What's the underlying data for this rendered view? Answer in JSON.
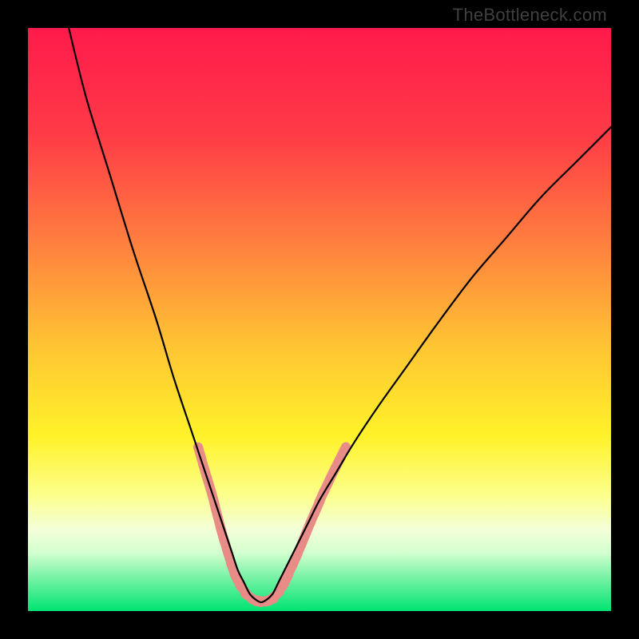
{
  "watermark": "TheBottleneck.com",
  "chart_data": {
    "type": "line",
    "title": "",
    "xlabel": "",
    "ylabel": "",
    "xlim": [
      0,
      100
    ],
    "ylim": [
      0,
      100
    ],
    "gradient_stops": [
      {
        "offset": 0,
        "color": "#ff1a4b"
      },
      {
        "offset": 18,
        "color": "#ff3a47"
      },
      {
        "offset": 35,
        "color": "#ff7840"
      },
      {
        "offset": 55,
        "color": "#ffc633"
      },
      {
        "offset": 70,
        "color": "#fff229"
      },
      {
        "offset": 80,
        "color": "#fcff8a"
      },
      {
        "offset": 86,
        "color": "#f4ffd8"
      },
      {
        "offset": 90,
        "color": "#d2ffcf"
      },
      {
        "offset": 94,
        "color": "#7df3a8"
      },
      {
        "offset": 100,
        "color": "#00e472"
      }
    ],
    "series": [
      {
        "name": "bottleneck-curve",
        "x": [
          7,
          10,
          14,
          18,
          22,
          25,
          28,
          30,
          32,
          34,
          35,
          36,
          37,
          38,
          39,
          40,
          41,
          42,
          43,
          44,
          46,
          48,
          50,
          53,
          56,
          60,
          65,
          70,
          76,
          82,
          88,
          94,
          100
        ],
        "y": [
          100,
          88,
          75,
          62,
          50,
          40,
          31,
          25,
          19,
          13,
          10,
          7,
          5,
          3,
          2,
          1.5,
          2,
          3,
          5,
          7,
          11,
          15,
          19,
          24,
          29,
          35,
          42,
          49,
          57,
          64,
          71,
          77,
          83
        ]
      }
    ],
    "marker_cluster": {
      "color": "#e98b87",
      "points": [
        {
          "x": 29.5,
          "y": 27
        },
        {
          "x": 30.3,
          "y": 24.2
        },
        {
          "x": 31,
          "y": 21.9
        },
        {
          "x": 31.7,
          "y": 19.5
        },
        {
          "x": 32.2,
          "y": 17.5
        },
        {
          "x": 32.8,
          "y": 15.2
        },
        {
          "x": 33.3,
          "y": 13.3
        },
        {
          "x": 33.9,
          "y": 11.3
        },
        {
          "x": 34.5,
          "y": 9.3
        },
        {
          "x": 35.2,
          "y": 7.1
        },
        {
          "x": 36,
          "y": 5.2
        },
        {
          "x": 37,
          "y": 3.6
        },
        {
          "x": 38.2,
          "y": 2.3
        },
        {
          "x": 39.6,
          "y": 1.8
        },
        {
          "x": 41,
          "y": 1.8
        },
        {
          "x": 42.2,
          "y": 2.5
        },
        {
          "x": 43.3,
          "y": 3.8
        },
        {
          "x": 44.2,
          "y": 5.3
        },
        {
          "x": 45,
          "y": 7.1
        },
        {
          "x": 45.8,
          "y": 8.8
        },
        {
          "x": 46.6,
          "y": 10.7
        },
        {
          "x": 47.3,
          "y": 12.4
        },
        {
          "x": 48,
          "y": 14.1
        },
        {
          "x": 48.8,
          "y": 16
        },
        {
          "x": 49.6,
          "y": 17.8
        },
        {
          "x": 50.4,
          "y": 19.7
        },
        {
          "x": 51.3,
          "y": 21.6
        },
        {
          "x": 52.2,
          "y": 23.5
        },
        {
          "x": 53.1,
          "y": 25.3
        },
        {
          "x": 54,
          "y": 27.1
        }
      ]
    }
  }
}
